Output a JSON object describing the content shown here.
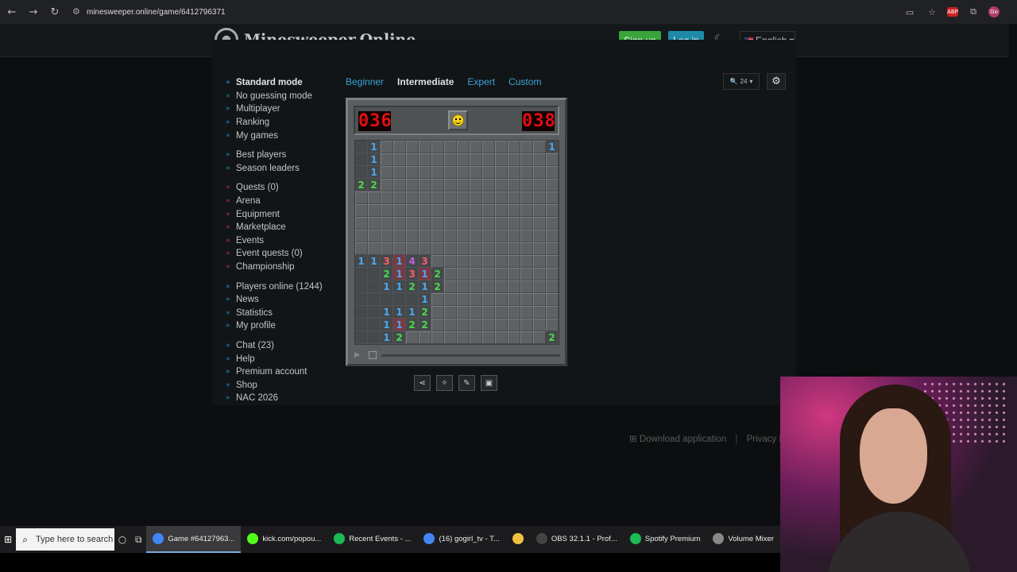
{
  "browser": {
    "url": "minesweeper.online/game/6412796371",
    "nav_back_icon": "back-arrow-icon",
    "nav_forward_icon": "forward-arrow-icon",
    "reload_icon": "reload-icon",
    "abp_label": "ABP",
    "profile_label": "Go"
  },
  "header": {
    "logo_text": "Minesweeper.Online",
    "signup_label": "Sign up",
    "login_label": "Log in",
    "language": "English"
  },
  "sidebar": {
    "groups": [
      [
        {
          "label": "Standard mode",
          "active": true
        },
        {
          "label": "No guessing mode"
        },
        {
          "label": "Multiplayer"
        },
        {
          "label": "Ranking"
        },
        {
          "label": "My games"
        }
      ],
      [
        {
          "label": "Best players"
        },
        {
          "label": "Season leaders"
        }
      ],
      [
        {
          "label": "Quests (0)"
        },
        {
          "label": "Arena"
        },
        {
          "label": "Equipment"
        },
        {
          "label": "Marketplace"
        },
        {
          "label": "Events"
        },
        {
          "label": "Event quests (0)"
        },
        {
          "label": "Championship"
        }
      ],
      [
        {
          "label": "Players online (1244)"
        },
        {
          "label": "News"
        },
        {
          "label": "Statistics"
        },
        {
          "label": "My profile"
        }
      ],
      [
        {
          "label": "Chat (23)"
        },
        {
          "label": "Help"
        },
        {
          "label": "Premium account"
        },
        {
          "label": "Shop"
        },
        {
          "label": "NAC 2026"
        }
      ]
    ]
  },
  "difficulty_tabs": [
    {
      "label": "Beginner"
    },
    {
      "label": "Intermediate",
      "active": true
    },
    {
      "label": "Expert"
    },
    {
      "label": "Custom"
    }
  ],
  "zoom_value": "24",
  "game": {
    "mines_counter": "036",
    "timer": "038",
    "board": [
      "o1cccccccccccccc1",
      "o1cccccccccccccc",
      "o1cccccccccccccc",
      "22cccccccccccccc",
      "cccccccccccccccc",
      "cccccccccccccccc",
      "cccccccccccccccc",
      "cccccccccccccccc",
      "cccccccccccccccc",
      "11314 3cccccccccc",
      "oo2131 2ccccccccc",
      "oo11212ccccccccc",
      "ooooo1cccccccccc",
      "oo1112cccccccccc",
      "oo1122cccccccccc",
      "oo112ccccccccc2"
    ]
  },
  "footer": {
    "download_label": "Download application",
    "privacy_label": "Privacy Po"
  },
  "taskbar": {
    "search_placeholder": "Type here to search",
    "tasks": [
      {
        "label": "Game #64127963...",
        "color": "#4285f4",
        "active": true
      },
      {
        "label": "kick.com/popou...",
        "color": "#53fc18"
      },
      {
        "label": "Recent Events - ...",
        "color": "#1db954"
      },
      {
        "label": "(16) gogirl_tv - T...",
        "color": "#4285f4"
      },
      {
        "label": "",
        "color": "#f0c040"
      },
      {
        "label": "OBS 32.1.1 - Prof...",
        "color": "#444"
      },
      {
        "label": "Spotify Premium",
        "color": "#1db954"
      },
      {
        "label": "Volume Mixer",
        "color": "#888"
      }
    ]
  }
}
